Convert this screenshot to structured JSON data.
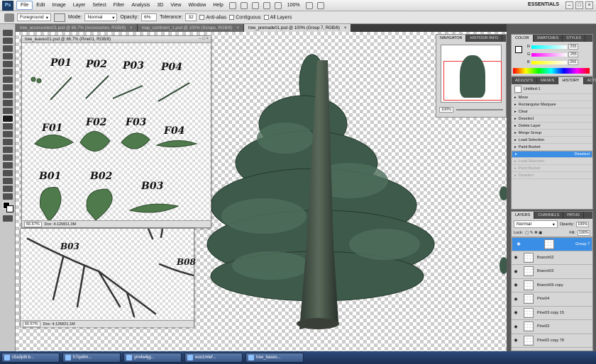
{
  "menu": {
    "items": [
      "File",
      "Edit",
      "Image",
      "Layer",
      "Select",
      "Filter",
      "Analysis",
      "3D",
      "View",
      "Window",
      "Help"
    ],
    "zoom": "100%",
    "workspace": "ESSENTIALS"
  },
  "options": {
    "fill_source": "Foreground",
    "mode_label": "Mode:",
    "mode_value": "Normal",
    "opacity_label": "Opacity:",
    "opacity_value": "6%",
    "tolerance_label": "Tolerance:",
    "tolerance_value": "32",
    "anti_alias": "Anti-alias",
    "contiguous": "Contiguous",
    "all_layers": "All Layers"
  },
  "doc_tabs": [
    "tree_accessories01.psd @ 66.7% (Accessories, RGB/8)",
    "map_continent_1.psd @ 100% (Scraps, RGB/8)",
    "tree_premade01.psd @ 100% (Group 7, RGB/8)"
  ],
  "leaves_window": {
    "title": "tree_leaves01.psd @ 66.7% (Pine01, RGB/8)",
    "labels": [
      "P01",
      "P02",
      "P03",
      "P04",
      "F01",
      "F02",
      "F03",
      "F04",
      "B01",
      "B02",
      "B03"
    ],
    "zoom": "66.67%",
    "doc": "Doc: 4.12M/11.3M"
  },
  "branch_window": {
    "labels": [
      "B03",
      "B08"
    ],
    "zoom": "66.67%",
    "doc": "Doc: 4.12M/21.1M"
  },
  "navigator": {
    "tabs": [
      "NAVIGATOR",
      "HISTOGR INFO"
    ],
    "zoom": "100%"
  },
  "color": {
    "tabs": [
      "COLOR",
      "SWATCHES",
      "STYLES"
    ],
    "channels": [
      {
        "label": "R",
        "value": "255"
      },
      {
        "label": "G",
        "value": "255"
      },
      {
        "label": "B",
        "value": "255"
      }
    ]
  },
  "history": {
    "tabs": [
      "ADJUSTS",
      "MASKS",
      "HISTORY",
      "ACTIONS"
    ],
    "snapshot": "Untitled-1",
    "items": [
      {
        "label": "Move",
        "state": "normal"
      },
      {
        "label": "Rectangular Marquee",
        "state": "normal"
      },
      {
        "label": "Clear",
        "state": "normal"
      },
      {
        "label": "Deselect",
        "state": "normal"
      },
      {
        "label": "Delete Layer",
        "state": "normal"
      },
      {
        "label": "Merge Group",
        "state": "normal"
      },
      {
        "label": "Load Selection",
        "state": "normal"
      },
      {
        "label": "Paint Bucket",
        "state": "normal"
      },
      {
        "label": "Deselect",
        "state": "selected"
      },
      {
        "label": "Load Selection",
        "state": "dim"
      },
      {
        "label": "Paint Bucket",
        "state": "dim"
      },
      {
        "label": "Deselect",
        "state": "dim"
      }
    ]
  },
  "layers": {
    "tabs": [
      "LAYERS",
      "CHANNELS",
      "PATHS"
    ],
    "blend": "Normal",
    "opacity_label": "Opacity:",
    "opacity": "100%",
    "lock_label": "Lock:",
    "fill_label": "Fill:",
    "fill": "100%",
    "items": [
      {
        "name": "Group 7",
        "selected": true
      },
      {
        "name": "Branch02",
        "selected": false
      },
      {
        "name": "Branch02",
        "selected": false
      },
      {
        "name": "Branch05 copy",
        "selected": false
      },
      {
        "name": "Pine04",
        "selected": false
      },
      {
        "name": "Pine03 copy 15",
        "selected": false
      },
      {
        "name": "Pine03",
        "selected": false
      },
      {
        "name": "Pine02 copy 78",
        "selected": false
      }
    ]
  },
  "taskbar": [
    "c5a3p8l.b...",
    "h7qv8m...",
    "ym4w4jg...",
    "eoo1mlef...",
    "tree_bases..."
  ]
}
